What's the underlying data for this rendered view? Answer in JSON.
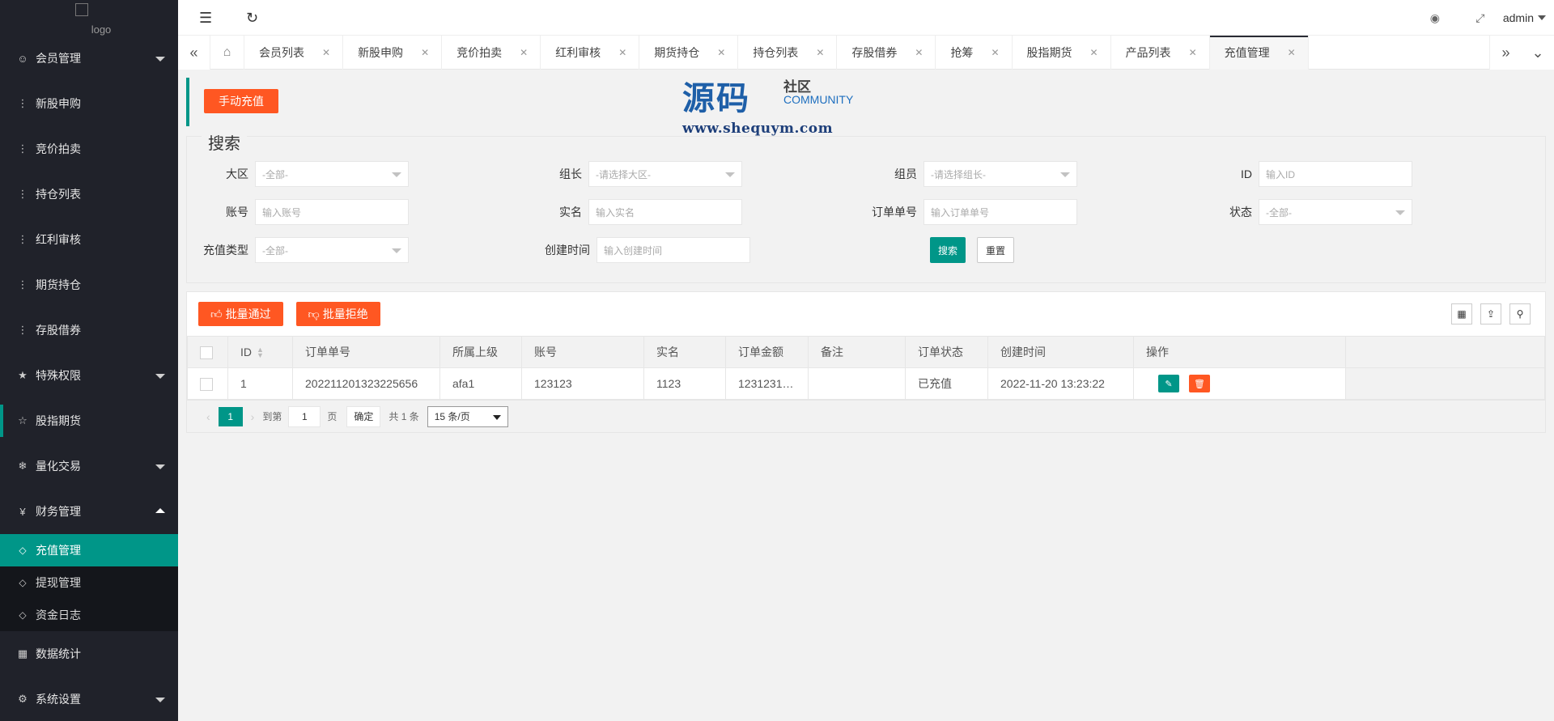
{
  "logo": {
    "alt": "logo"
  },
  "sidebar": {
    "items": [
      {
        "label": "会员管理",
        "icon": "user-icon",
        "expandable": true
      },
      {
        "label": "新股申购",
        "icon": "dots-icon"
      },
      {
        "label": "竞价拍卖",
        "icon": "dots-icon"
      },
      {
        "label": "持仓列表",
        "icon": "dots-icon"
      },
      {
        "label": "红利审核",
        "icon": "dots-icon"
      },
      {
        "label": "期货持仓",
        "icon": "dots-icon"
      },
      {
        "label": "存股借券",
        "icon": "dots-icon"
      },
      {
        "label": "特殊权限",
        "icon": "star-icon",
        "expandable": true
      },
      {
        "label": "股指期货",
        "icon": "star-outline-icon"
      },
      {
        "label": "量化交易",
        "icon": "snowflake-icon",
        "expandable": true
      },
      {
        "label": "财务管理",
        "icon": "yen-icon",
        "expanded": true
      }
    ],
    "finance_sub": [
      {
        "label": "充值管理",
        "icon": "diamond-icon",
        "active": true
      },
      {
        "label": "提现管理",
        "icon": "diamond-icon"
      },
      {
        "label": "资金日志",
        "icon": "diamond-icon"
      }
    ],
    "bottom_items": [
      {
        "label": "数据统计",
        "icon": "calendar-icon"
      },
      {
        "label": "系统设置",
        "icon": "gear-icon",
        "expandable": true
      }
    ]
  },
  "header": {
    "user": "admin"
  },
  "tabs": [
    {
      "label": "会员列表"
    },
    {
      "label": "新股申购"
    },
    {
      "label": "竞价拍卖"
    },
    {
      "label": "红利审核"
    },
    {
      "label": "期货持仓"
    },
    {
      "label": "持仓列表"
    },
    {
      "label": "存股借券"
    },
    {
      "label": "抢筹"
    },
    {
      "label": "股指期货"
    },
    {
      "label": "产品列表"
    },
    {
      "label": "充值管理",
      "active": true
    }
  ],
  "top_action": {
    "label": "手动充值"
  },
  "watermark": {
    "big": "源码",
    "small": "社区",
    "community": "COMMUNITY",
    "url": "www.shequym.com"
  },
  "search": {
    "legend": "搜索",
    "fields": {
      "region": {
        "label": "大区",
        "placeholder": "-全部-"
      },
      "leader": {
        "label": "组长",
        "placeholder": "-请选择大区-"
      },
      "member": {
        "label": "组员",
        "placeholder": "-请选择组长-"
      },
      "id": {
        "label": "ID",
        "placeholder": "输入ID"
      },
      "account": {
        "label": "账号",
        "placeholder": "输入账号"
      },
      "realname": {
        "label": "实名",
        "placeholder": "输入实名"
      },
      "order_no": {
        "label": "订单单号",
        "placeholder": "输入订单单号"
      },
      "status": {
        "label": "状态",
        "placeholder": "-全部-"
      },
      "recharge_type": {
        "label": "充值类型",
        "placeholder": "-全部-"
      },
      "created": {
        "label": "创建时间",
        "placeholder": "输入创建时间"
      }
    },
    "search_btn": "搜索",
    "reset_btn": "重置"
  },
  "toolbar": {
    "approve": "批量通过",
    "reject": "批量拒绝"
  },
  "table": {
    "columns": [
      "ID",
      "订单单号",
      "所属上级",
      "账号",
      "实名",
      "订单金额",
      "备注",
      "订单状态",
      "创建时间",
      "操作"
    ],
    "rows": [
      {
        "id": "1",
        "order_no": "202211201323225656",
        "parent": "afa1",
        "account": "123123",
        "realname": "1123",
        "amount": "1231231…",
        "remark": "",
        "status": "已充值",
        "created": "2022-11-20 13:23:22"
      }
    ]
  },
  "pager": {
    "current": "1",
    "goto_prefix": "到第",
    "goto_value": "1",
    "page_suffix": "页",
    "confirm": "确定",
    "total": "共 1 条",
    "page_size": "15 条/页"
  }
}
